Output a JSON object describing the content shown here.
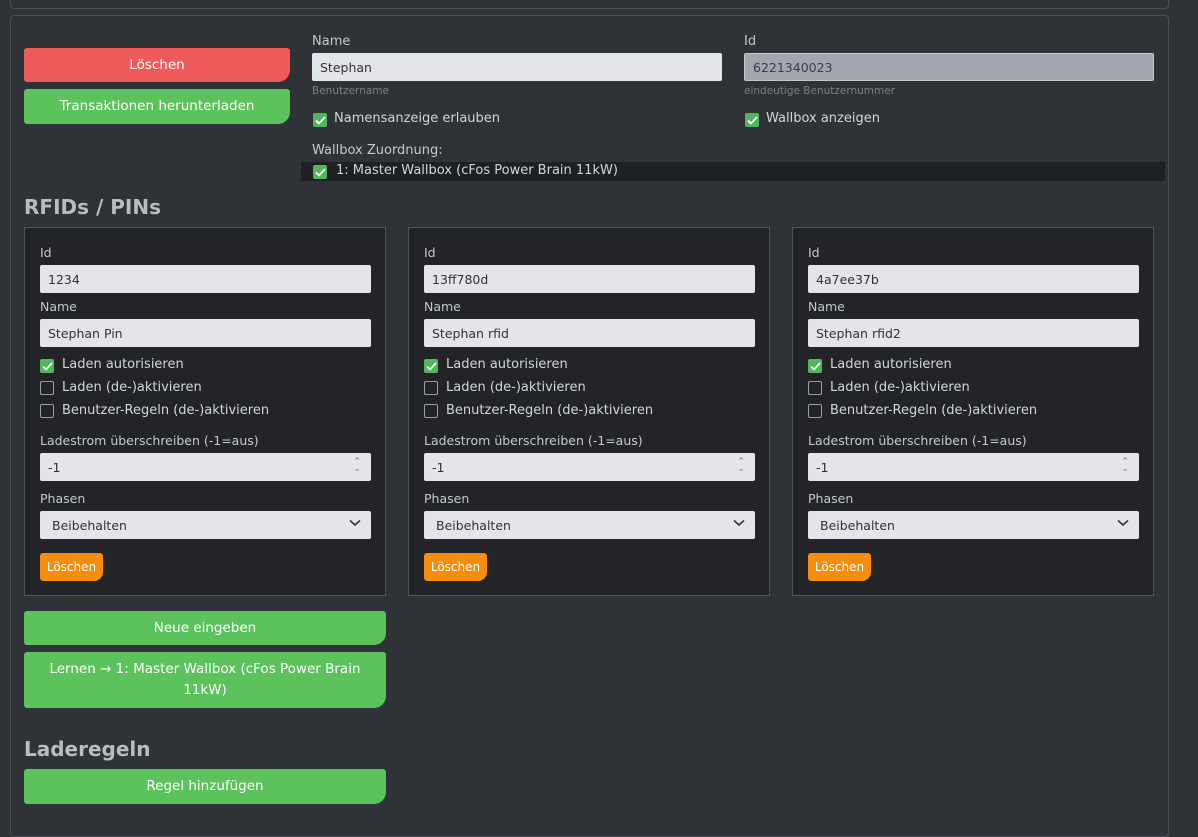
{
  "user": {
    "delete_button": "Löschen",
    "download_button": "Transaktionen herunterladen",
    "name_label": "Name",
    "name_value": "Stephan",
    "name_hint": "Benutzername",
    "id_label": "Id",
    "id_value": "6221340023",
    "id_hint": "eindeutige Benutzernummer",
    "allow_name_label": "Namensanzeige erlauben",
    "allow_name_checked": true,
    "show_wallbox_label": "Wallbox anzeigen",
    "show_wallbox_checked": true,
    "assignment_label": "Wallbox Zuordnung:",
    "assignment_item": "1: Master Wallbox (cFos Power Brain 11kW)",
    "assignment_checked": true
  },
  "rfids": {
    "title": "RFIDs / PINs",
    "field_labels": {
      "id": "Id",
      "name": "Name",
      "charge_auth": "Laden autorisieren",
      "charge_toggle": "Laden (de-)aktivieren",
      "rules_toggle": "Benutzer-Regeln (de-)aktivieren",
      "current_override": "Ladestrom überschreiben (-1=aus)",
      "phases": "Phasen",
      "delete": "Löschen"
    },
    "cards": [
      {
        "id": "1234",
        "name": "Stephan Pin",
        "charge_auth": true,
        "charge_toggle": false,
        "rules_toggle": false,
        "current": "-1",
        "phases": "Beibehalten"
      },
      {
        "id": "13ff780d",
        "name": "Stephan rfid",
        "charge_auth": true,
        "charge_toggle": false,
        "rules_toggle": false,
        "current": "-1",
        "phases": "Beibehalten"
      },
      {
        "id": "4a7ee37b",
        "name": "Stephan rfid2",
        "charge_auth": true,
        "charge_toggle": false,
        "rules_toggle": false,
        "current": "-1",
        "phases": "Beibehalten"
      }
    ],
    "new_button": "Neue eingeben",
    "learn_button_line1": "Lernen → 1: Master Wallbox (cFos Power Brain",
    "learn_button_line2": "11kW)"
  },
  "rules": {
    "title": "Laderegeln",
    "add_button": "Regel hinzufügen"
  },
  "colors": {
    "background": "#2f3237",
    "danger": "#ef5b5b",
    "success": "#5cc25c",
    "warning": "#f68c0c",
    "check": "#50b85a"
  }
}
